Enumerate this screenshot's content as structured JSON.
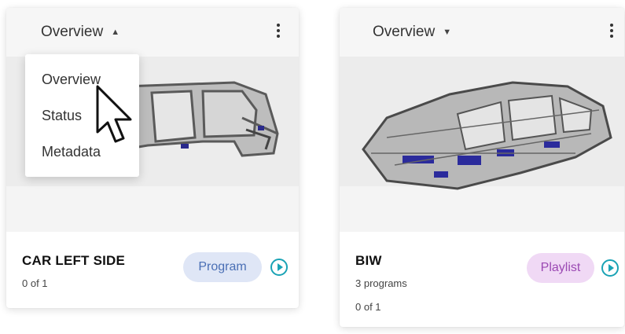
{
  "cards": [
    {
      "view_select": "Overview",
      "title": "CAR LEFT SIDE",
      "progress": "0 of 1",
      "badge": "Program",
      "dropdown_open": true,
      "menu": [
        "Overview",
        "Status",
        "Metadata"
      ]
    },
    {
      "view_select": "Overview",
      "title": "BIW",
      "programs": "3 programs",
      "progress": "0 of 1",
      "badge": "Playlist",
      "dropdown_open": false
    }
  ],
  "icons": {
    "menu": "kebab-vertical-icon",
    "play": "play-circle-icon",
    "caret_up": "caret-up-icon",
    "caret_down": "caret-down-icon",
    "cursor": "mouse-pointer-icon"
  },
  "colors": {
    "program_badge_bg": "#dfe6f6",
    "program_badge_text": "#4a6fb5",
    "playlist_badge_bg": "#f0d9f5",
    "playlist_badge_text": "#9b49b3",
    "play_accent": "#1aa3b5"
  }
}
